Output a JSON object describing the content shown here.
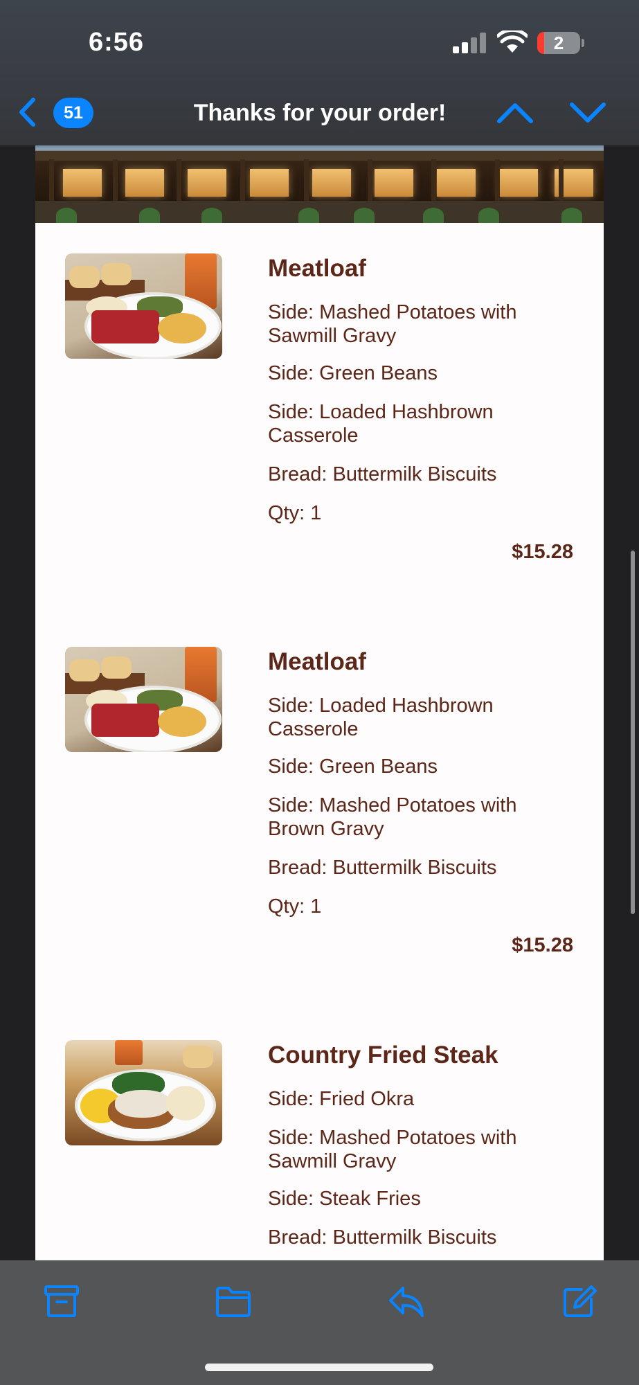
{
  "status_bar": {
    "time": "6:56",
    "battery_level": "2",
    "battery_color": "#ff3b30"
  },
  "nav": {
    "unread_count": "51",
    "title": "Thanks for your order!",
    "accent_color": "#0a84ff",
    "icons": [
      "back-chevron-icon",
      "previous-message-icon",
      "next-message-icon"
    ]
  },
  "order": {
    "items": [
      {
        "name": "Meatloaf",
        "options": [
          "Side: Mashed Potatoes with Sawmill Gravy",
          "Side: Green Beans",
          "Side: Loaded Hashbrown Casserole",
          "Bread: Buttermilk Biscuits",
          "Qty: 1"
        ],
        "price": "$15.28"
      },
      {
        "name": "Meatloaf",
        "options": [
          "Side: Loaded Hashbrown Casserole",
          "Side: Green Beans",
          "Side: Mashed Potatoes with Brown Gravy",
          "Bread: Buttermilk Biscuits",
          "Qty: 1"
        ],
        "price": "$15.28"
      },
      {
        "name": "Country Fried Steak",
        "options": [
          "Side: Fried Okra",
          "Side: Mashed Potatoes with Sawmill Gravy",
          "Side: Steak Fries",
          "Bread: Buttermilk Biscuits"
        ]
      }
    ],
    "text_color": "#5c2718"
  },
  "toolbar": {
    "icons": [
      "archive-icon",
      "move-to-folder-icon",
      "reply-icon",
      "compose-icon"
    ]
  }
}
